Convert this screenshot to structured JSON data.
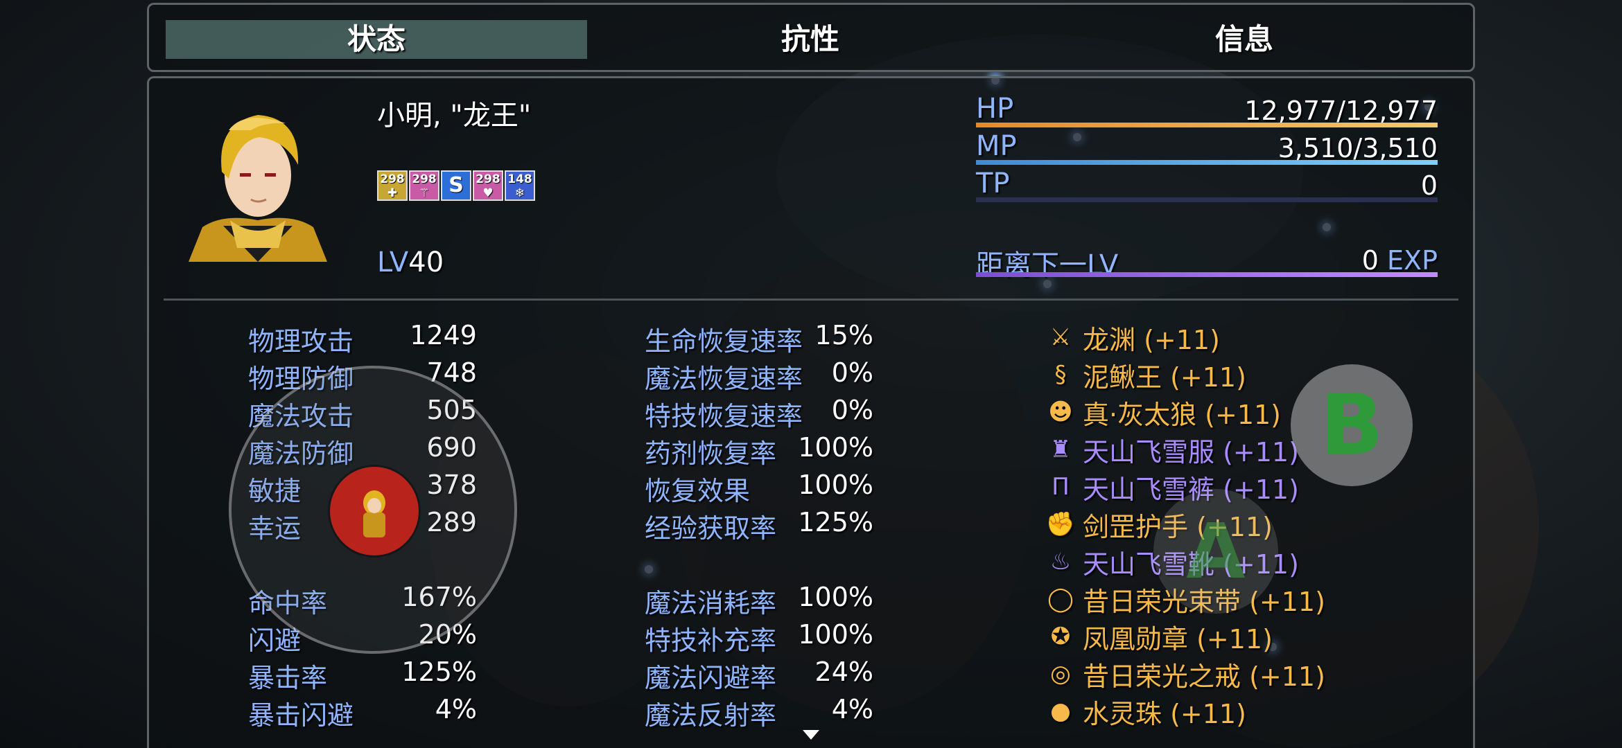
{
  "tabs": [
    {
      "label": "状态",
      "active": true
    },
    {
      "label": "抗性",
      "active": false
    },
    {
      "label": "信息",
      "active": false
    }
  ],
  "character": {
    "name": "小明, \"龙王\"",
    "level_prefix": "LV",
    "level": "40",
    "states": [
      {
        "turns": "298",
        "color": "#c8a634",
        "icon": "sword-up-icon"
      },
      {
        "turns": "298",
        "color": "#c95aa6",
        "icon": "shield-up-icon"
      },
      {
        "turns": "",
        "color": "#2c6fd8",
        "icon": "serpent-icon"
      },
      {
        "turns": "298",
        "color": "#c95aa6",
        "icon": "heart-up-icon"
      },
      {
        "turns": "148",
        "color": "#3a5ed0",
        "icon": "snowflake-icon"
      }
    ]
  },
  "gauges": {
    "hp": {
      "label": "HP",
      "value": "12,977/12,977",
      "fill": 1.0,
      "color_from": "#e38a2e",
      "color_to": "#f2c870"
    },
    "mp": {
      "label": "MP",
      "value": "3,510/3,510",
      "fill": 1.0,
      "color_from": "#3e8bd8",
      "color_to": "#7cd0ff"
    },
    "tp": {
      "label": "TP",
      "value": "0",
      "fill": 0.0,
      "color_from": "#3aa34a",
      "color_to": "#8ee08e"
    },
    "exp": {
      "label": "距离下一LV",
      "value_num": "0",
      "value_unit": "EXP",
      "fill": 1.0,
      "color_from": "#7a4fd0",
      "color_to": "#c28cff"
    }
  },
  "params": [
    {
      "label": "物理攻击",
      "value": "1249"
    },
    {
      "label": "物理防御",
      "value": "748"
    },
    {
      "label": "魔法攻击",
      "value": "505"
    },
    {
      "label": "魔法防御",
      "value": "690"
    },
    {
      "label": "敏捷",
      "value": "378"
    },
    {
      "label": "幸运",
      "value": "289"
    }
  ],
  "xparams": [
    {
      "label": "命中率",
      "value": "167%"
    },
    {
      "label": "闪避",
      "value": "20%"
    },
    {
      "label": "暴击率",
      "value": "125%"
    },
    {
      "label": "暴击闪避",
      "value": "4%"
    }
  ],
  "sparams_top": [
    {
      "label": "生命恢复速率",
      "value": "15%"
    },
    {
      "label": "魔法恢复速率",
      "value": "0%"
    },
    {
      "label": "特技恢复速率",
      "value": "0%"
    },
    {
      "label": "药剂恢复率",
      "value": "100%"
    },
    {
      "label": "恢复效果",
      "value": "100%"
    },
    {
      "label": "经验获取率",
      "value": "125%"
    }
  ],
  "sparams_bottom": [
    {
      "label": "魔法消耗率",
      "value": "100%"
    },
    {
      "label": "特技补充率",
      "value": "100%"
    },
    {
      "label": "魔法闪避率",
      "value": "24%"
    },
    {
      "label": "魔法反射率",
      "value": "4%"
    }
  ],
  "equipment": [
    {
      "name": "龙渊 (+11)",
      "color": "#f6b94a",
      "icon": "spear-icon",
      "glyph": "⚔"
    },
    {
      "name": "泥鳅王 (+11)",
      "color": "#f6b94a",
      "icon": "eel-icon",
      "glyph": "§"
    },
    {
      "name": "真·灰太狼 (+11)",
      "color": "#f6b94a",
      "icon": "wolf-icon",
      "glyph": "☻"
    },
    {
      "name": "天山飞雪服 (+11)",
      "color": "#a98cff",
      "icon": "robe-icon",
      "glyph": "♜"
    },
    {
      "name": "天山飞雪裤 (+11)",
      "color": "#a98cff",
      "icon": "pants-icon",
      "glyph": "Π"
    },
    {
      "name": "剑罡护手 (+11)",
      "color": "#f6b94a",
      "icon": "gauntlet-icon",
      "glyph": "✊"
    },
    {
      "name": "天山飞雪靴 (+11)",
      "color": "#a98cff",
      "icon": "boots-icon",
      "glyph": "♨"
    },
    {
      "name": "昔日荣光束带 (+11)",
      "color": "#f6b94a",
      "icon": "belt-icon",
      "glyph": "◯"
    },
    {
      "name": "凤凰勋章 (+11)",
      "color": "#f6b94a",
      "icon": "medal-icon",
      "glyph": "✪"
    },
    {
      "name": "昔日荣光之戒 (+11)",
      "color": "#f6b94a",
      "icon": "ring-icon",
      "glyph": "◎"
    },
    {
      "name": "水灵珠 (+11)",
      "color": "#f6b94a",
      "icon": "orb-icon",
      "glyph": "●"
    }
  ],
  "controls": {
    "button_b": "B",
    "button_a": "A"
  }
}
